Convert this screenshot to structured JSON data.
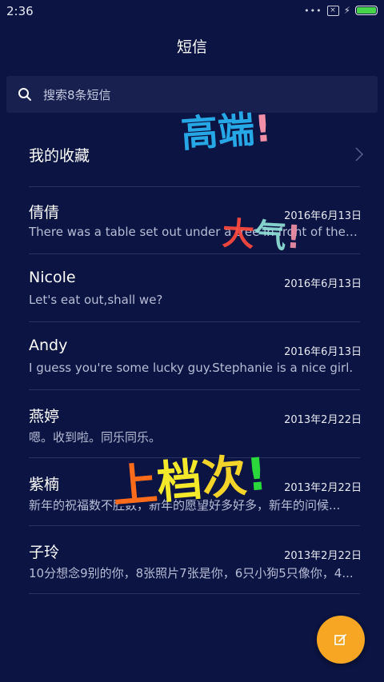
{
  "status": {
    "time": "2:36",
    "battery_level": 1.0
  },
  "header": {
    "title": "短信"
  },
  "search": {
    "placeholder": "搜索8条短信"
  },
  "favorites": {
    "label": "我的收藏"
  },
  "messages": [
    {
      "name": "倩倩",
      "date": "2016年6月13日",
      "preview": "There was a table set out under a tree in front of the ho..."
    },
    {
      "name": "Nicole",
      "date": "2016年6月13日",
      "preview": "Let's eat out,shall we?"
    },
    {
      "name": "Andy",
      "date": "2016年6月13日",
      "preview": "I guess you're some lucky guy.Stephanie is a nice girl."
    },
    {
      "name": "燕婷",
      "date": "2013年2月22日",
      "preview": "嗯。收到啦。同乐同乐。"
    },
    {
      "name": "紫楠",
      "date": "2013年2月22日",
      "preview": "新年的祝福数不胜数，新年的愿望好多好多，新年的问候..."
    },
    {
      "name": "子玲",
      "date": "2013年2月22日",
      "preview": "10分想念9别的你，8张照片7张是你，6只小狗5只像你，4..."
    }
  ],
  "stickers": {
    "s1": {
      "text": "高端",
      "ex": "!"
    },
    "s2": {
      "text": "大",
      "qi": "气",
      "ex": "!"
    },
    "s3": {
      "c1": "上",
      "c2": "档",
      "c3": "次",
      "ex": "!"
    }
  },
  "icons": {
    "search": "search-icon",
    "chevron": "chevron-right-icon",
    "compose": "compose-icon"
  },
  "colors": {
    "background": "#0b1442",
    "accent": "#f6a623",
    "battery": "#46d44b"
  }
}
